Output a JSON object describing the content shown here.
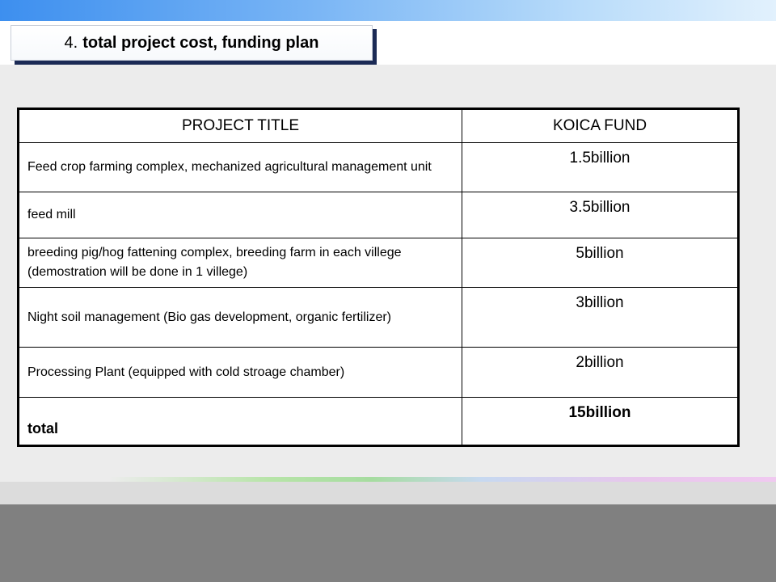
{
  "slide": {
    "title_number": "4.",
    "title_text": "total project cost, funding plan"
  },
  "table": {
    "headers": [
      "PROJECT TITLE",
      "KOICA FUND"
    ],
    "rows": [
      {
        "project": "Feed crop farming complex, mechanized agricultural management unit",
        "fund": "1.5billion"
      },
      {
        "project": "feed mill",
        "fund": "3.5billion"
      },
      {
        "project": "breeding pig/hog fattening complex, breeding farm in each villege (demostration will be done in 1 villege)",
        "fund": "5billion"
      },
      {
        "project": "Night soil management (Bio gas development, organic fertilizer)",
        "fund": "3billion"
      },
      {
        "project": "Processing Plant (equipped with cold stroage chamber)",
        "fund": "2billion"
      }
    ],
    "total": {
      "project": "total",
      "fund": "15billion"
    }
  }
}
